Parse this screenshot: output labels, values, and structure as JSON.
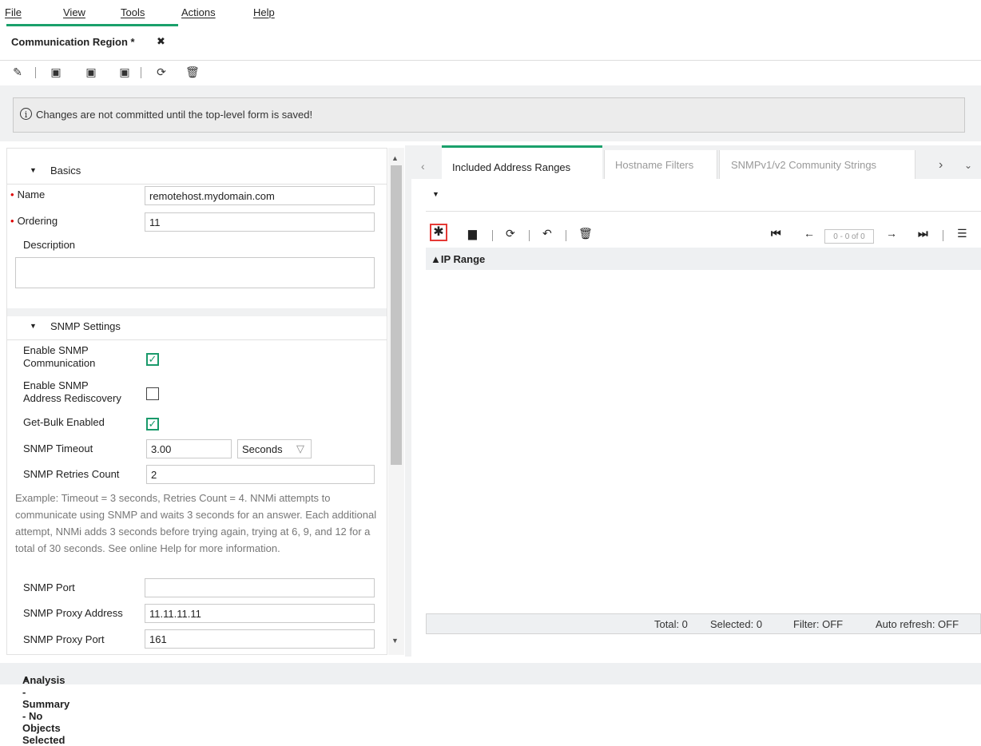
{
  "menu": {
    "file": "File",
    "view": "View",
    "tools": "Tools",
    "actions": "Actions",
    "help": "Help"
  },
  "tab": {
    "title": "Communication Region *",
    "close": "✖"
  },
  "notice": {
    "text": "Changes are not committed until the top-level form is saved!",
    "icon": "i"
  },
  "basics": {
    "heading": "Basics",
    "name_label": "Name",
    "name_value": "remotehost.mydomain.com",
    "ordering_label": "Ordering",
    "ordering_value": "11",
    "description_label": "Description",
    "description_value": ""
  },
  "snmp": {
    "heading": "SNMP Settings",
    "enable_comm_label_1": "Enable SNMP",
    "enable_comm_label_2": "Communication",
    "enable_comm_checked": true,
    "rediscovery_label_1": "Enable SNMP",
    "rediscovery_label_2": "Address Rediscovery",
    "rediscovery_checked": false,
    "getbulk_label": "Get-Bulk Enabled",
    "getbulk_checked": true,
    "timeout_label": "SNMP Timeout",
    "timeout_value": "3.00",
    "timeout_unit": "Seconds",
    "retries_label": "SNMP Retries Count",
    "retries_value": "2",
    "note": "Example: Timeout = 3 seconds, Retries Count = 4. NNMi attempts to communicate using SNMP and waits 3 seconds for an answer. Each additional attempt, NNMi adds 3 seconds before trying again, trying at 6, 9, and 12 for a total of 30 seconds. See online Help for more information.",
    "port_label": "SNMP Port",
    "port_value": "",
    "proxy_address_label": "SNMP Proxy Address",
    "proxy_address_value": "11.11.11.11",
    "proxy_port_label": "SNMP Proxy Port",
    "proxy_port_value": "161"
  },
  "right_tabs": {
    "included": "Included Address Ranges",
    "hostname": "Hostname Filters",
    "community": "SNMPv1/v2 Community Strings"
  },
  "grid": {
    "column": "▲IP Range",
    "pager": "0 - 0 of 0"
  },
  "status": {
    "total": "Total: 0",
    "selected": "Selected: 0",
    "filter": "Filter: OFF",
    "auto_refresh": "Auto refresh: OFF"
  },
  "bottom": {
    "text": "Analysis - Summary - No Objects Selected"
  }
}
